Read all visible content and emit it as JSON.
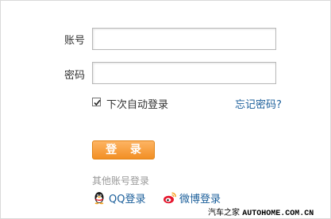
{
  "form": {
    "account_label": "账号",
    "account_value": "",
    "password_label": "密码",
    "password_value": "",
    "remember_label": "下次自动登录",
    "remember_checked": true,
    "forgot_label": "忘记密码?",
    "login_label": "登 录",
    "other_accounts_label": "其他账号登录"
  },
  "social": {
    "qq_label": "QQ登录",
    "qq_icon": "qq-penguin-icon",
    "weibo_label": "微博登录",
    "weibo_icon": "weibo-icon"
  },
  "watermark": {
    "cn": "汽车之家 ",
    "en": "AUTOHOME.COM.CN"
  },
  "colors": {
    "accent_orange": "#f28f24",
    "link_blue": "#1a5e9a",
    "weibo_red": "#e6162d"
  }
}
